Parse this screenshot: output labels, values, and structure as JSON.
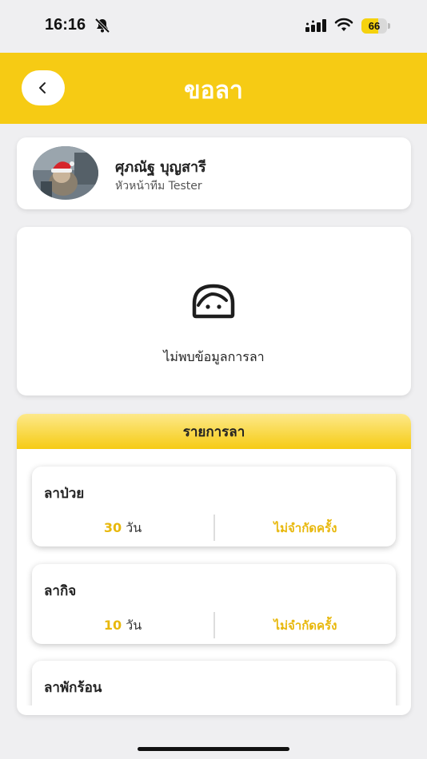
{
  "status_bar": {
    "time": "16:16",
    "battery_level": "66",
    "battery_fraction": 0.66,
    "icons": [
      "bell-slash-icon",
      "signal-icon",
      "wifi-icon",
      "battery-icon"
    ]
  },
  "header": {
    "title": "ขอลา",
    "back_icon": "chevron-left-icon",
    "background_color": "#f6cb14"
  },
  "profile": {
    "name": "ศุภณัฐ บุญสารี",
    "role": "หัวหน้าทีม Tester"
  },
  "empty_state": {
    "icon": "person-face-icon",
    "message": "ไม่พบข้อมูลการลา"
  },
  "leave_list": {
    "title": "รายการลา",
    "unit_label": "วัน",
    "items": [
      {
        "name": "ลาป่วย",
        "days": "30",
        "limit": "ไม่จำกัดครั้ง"
      },
      {
        "name": "ลากิจ",
        "days": "10",
        "limit": "ไม่จำกัดครั้ง"
      },
      {
        "name": "ลาพักร้อน",
        "days": "",
        "limit": ""
      }
    ]
  },
  "colors": {
    "accent": "#f6cb14",
    "value_text": "#e8b80d"
  }
}
